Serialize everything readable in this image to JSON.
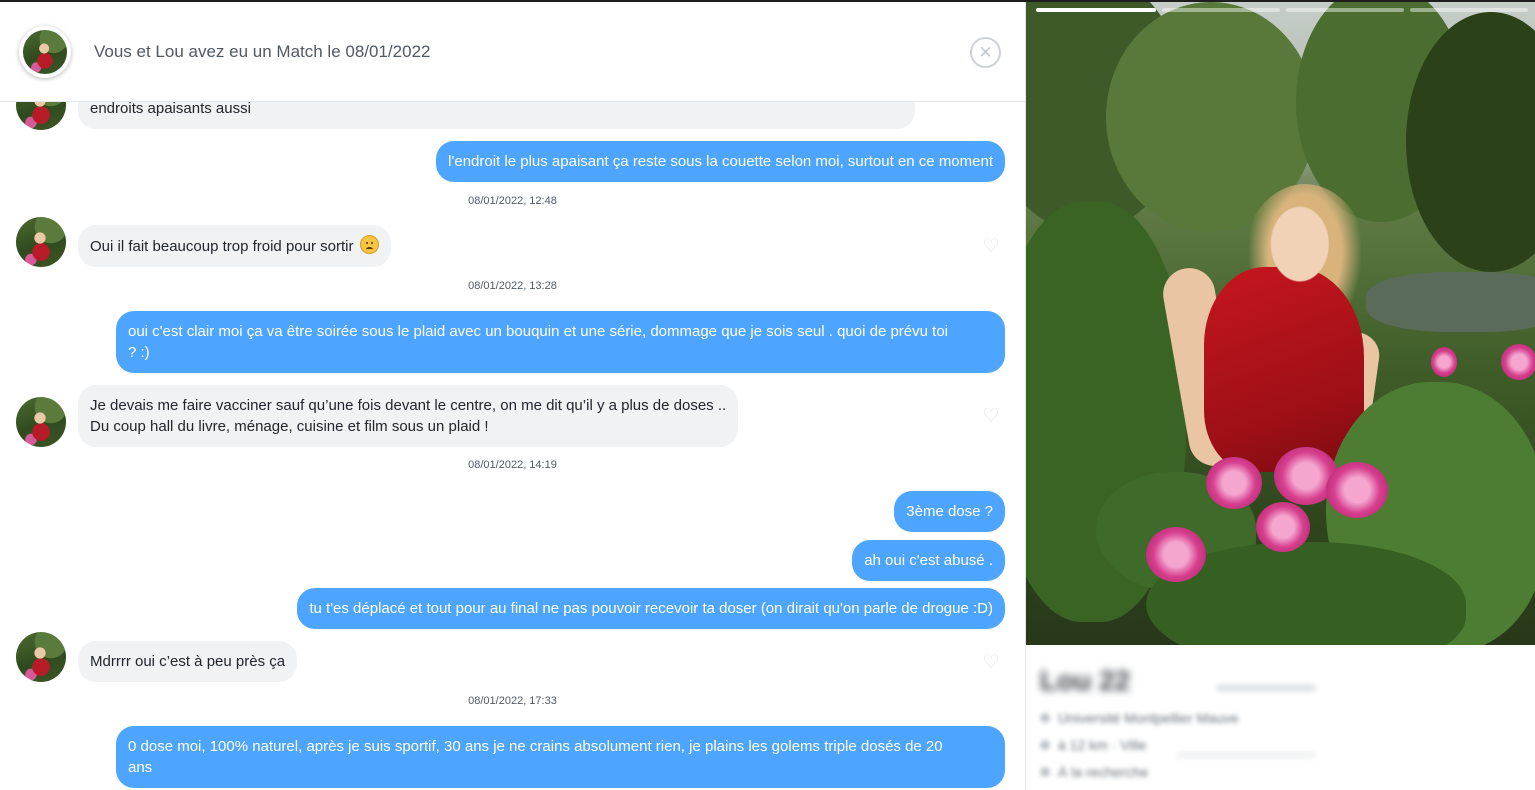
{
  "header": {
    "title": "Vous et Lou avez eu un Match le 08/01/2022",
    "close_icon": "close-icon"
  },
  "messages": [
    {
      "text": "endroits apaisants aussi"
    },
    {
      "text": "l'endroit le plus apaisant ça reste sous la couette selon moi, surtout en ce moment"
    },
    {
      "text": "Oui il fait beaucoup trop froid pour sortir"
    },
    {
      "text_1": "oui c'est clair moi ça va être soirée sous le plaid avec un bouquin et une série, dommage que je sois seul . quoi de prévu toi",
      "text_2": "? :)"
    },
    {
      "text_1": "Je devais me faire vacciner sauf qu’une fois devant le centre, on me dit qu’il y a plus de doses ..",
      "text_2": "Du coup hall du livre, ménage, cuisine et film sous un plaid !"
    },
    {
      "text": "3ème dose ?"
    },
    {
      "text": "ah oui c'est abusé ."
    },
    {
      "text": "tu t'es déplacé et  tout pour au final ne pas pouvoir recevoir  ta doser (on dirait qu'on parle de drogue :D)"
    },
    {
      "text": "Mdrrrr oui c’est à peu près ça"
    },
    {
      "text_1": "0 dose moi, 100% naturel, après je suis sportif, 30 ans je ne crains absolument rien, je plains les golems triple dosés de 20",
      "text_2": "ans"
    }
  ],
  "timestamps": [
    "08/01/2022, 12:48",
    "08/01/2022, 13:28",
    "08/01/2022, 14:19",
    "08/01/2022, 17:33"
  ],
  "emoji": "worried-face-icon",
  "profile": {
    "photo_count": 4,
    "photo_active_index": 0,
    "name_blurred": "Lou 22",
    "info_blurred": [
      "Université Montpellier Mauve",
      "à 12 km · Ville",
      "À la recherche"
    ]
  },
  "colors": {
    "outgoing_bubble": "#4ea5ff",
    "incoming_bubble": "#f0f2f4",
    "accent_text": "#505965"
  }
}
